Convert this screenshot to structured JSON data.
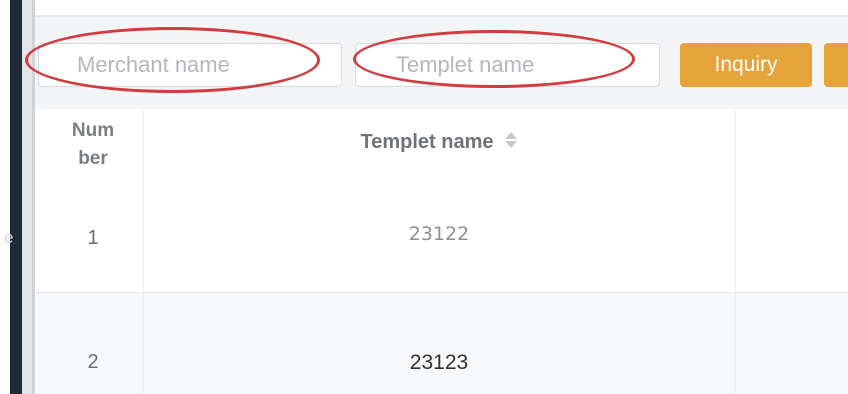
{
  "search": {
    "merchant_placeholder": "Merchant name",
    "templet_placeholder": "Templet name",
    "inquiry_label": "Inquiry",
    "annotation_color": "#d23b3f",
    "button_color": "#e6a33a"
  },
  "sidebar": {
    "partial_glyph": "e"
  },
  "table": {
    "headers": {
      "number": "Num ber",
      "templet_name": "Templet name"
    },
    "sort_icon": "sort-updown-icon",
    "rows": [
      {
        "number": "1",
        "templet_name": "23122"
      },
      {
        "number": "2",
        "templet_name": "23123"
      }
    ]
  }
}
